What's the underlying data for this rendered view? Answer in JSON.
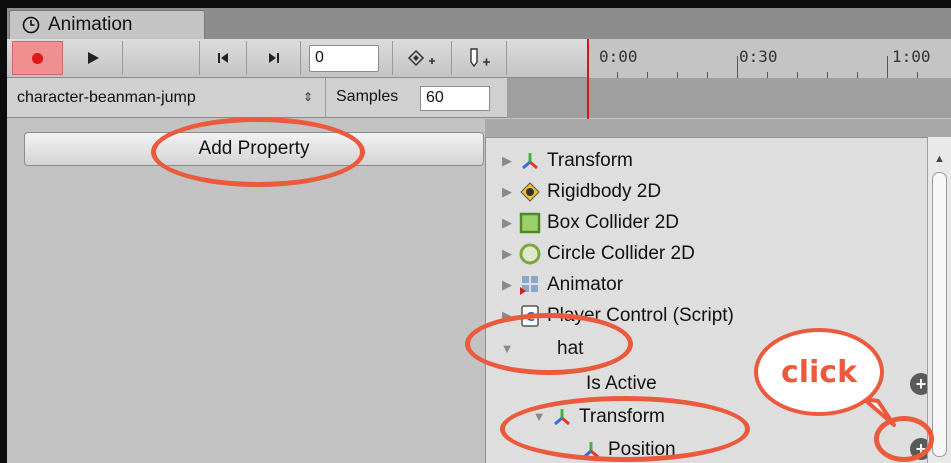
{
  "window": {
    "tab_title": "Animation"
  },
  "toolbar": {
    "frame_value": "0",
    "timeline_labels": [
      "0:00",
      "0:30",
      "1:00"
    ]
  },
  "clip": {
    "name": "character-beanman-jump",
    "samples_label": "Samples",
    "samples_value": "60"
  },
  "left": {
    "add_property_label": "Add Property"
  },
  "property_list": [
    {
      "label": "Transform",
      "icon": "transform-icon",
      "expander": "collapsed"
    },
    {
      "label": "Rigidbody 2D",
      "icon": "rigidbody-icon",
      "expander": "collapsed"
    },
    {
      "label": "Box Collider 2D",
      "icon": "box-collider-icon",
      "expander": "collapsed"
    },
    {
      "label": "Circle Collider 2D",
      "icon": "circle-collider-icon",
      "expander": "collapsed"
    },
    {
      "label": "Animator",
      "icon": "animator-icon",
      "expander": "collapsed"
    },
    {
      "label": "Player Control (Script)",
      "icon": "script-icon",
      "expander": "collapsed"
    },
    {
      "label": "hat",
      "icon": "",
      "expander": "expanded"
    },
    {
      "label": "Is Active",
      "icon": "",
      "expander": "none"
    },
    {
      "label": "Transform",
      "icon": "transform-icon",
      "expander": "expanded"
    },
    {
      "label": "Position",
      "icon": "transform-icon",
      "expander": "none"
    }
  ],
  "annotation": {
    "callout_text": "click"
  },
  "colors": {
    "highlight": "#ec5a3e",
    "record": "#e01818",
    "playhead": "#d01a1a"
  }
}
